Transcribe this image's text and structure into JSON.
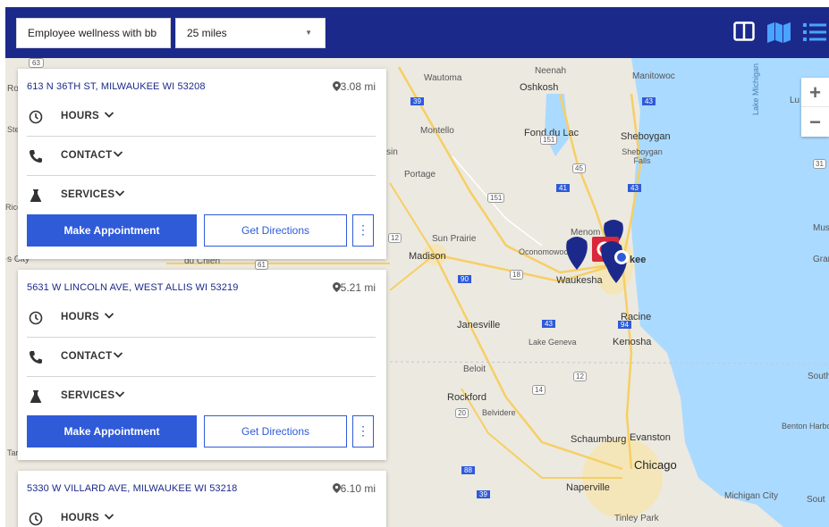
{
  "toolbar": {
    "search_value": "Employee wellness with bb",
    "radius_value": "25 miles",
    "view_icons": [
      "split-view-icon",
      "map-view-icon",
      "list-view-icon"
    ],
    "accent_color": "#1b2a8a",
    "button_color": "#2f5bd9"
  },
  "map": {
    "zoom_in": "+",
    "zoom_out": "−",
    "labels": {
      "waupaca": "Wautoma",
      "oshkosh": "Oshkosh",
      "neenah": "Neenah",
      "manitowoc": "Manitowoc",
      "montello": "Montello",
      "fonddulac": "Fond du Lac",
      "sheboygan": "Sheboygan",
      "sheboyganfalls": "Sheboygan Falls",
      "portage": "Portage",
      "sunprairie": "Sun Prairie",
      "madison": "Madison",
      "oconomowoc": "Oconomowoc",
      "menomonee": "Menom",
      "milwaukee": "kee",
      "waukesha": "Waukesha",
      "janesville": "Janesville",
      "racine": "Racine",
      "lakegeneva": "Lake Geneva",
      "kenosha": "Kenosha",
      "beloit": "Beloit",
      "rockford": "Rockford",
      "belvidere": "Belvidere",
      "schaumburg": "Schaumburg",
      "evanston": "Evanston",
      "chicago": "Chicago",
      "naperville": "Naperville",
      "tinleypark": "Tinley Park",
      "michigancity": "Michigan City",
      "southhaven": "South",
      "bentonharbor": "Benton Harbo",
      "grand": "Gran",
      "muskegon": "Mus",
      "lakemichigan": "Lake Michigan",
      "ludington": "Lu",
      "duchien": "du Chien",
      "ro": "Ro",
      "ste": "Ste",
      "ric": "Rice",
      "scity": "s City",
      "sin": "sin",
      "sout": "Sout",
      "tar": "Tar",
      "hw63": "63",
      "hw10": "10",
      "hw41": "41",
      "hw151": "151",
      "hw45": "45",
      "hw43": "43",
      "hw90": "90",
      "hw39": "39",
      "hw12": "12",
      "hw18": "18",
      "hw94": "94",
      "hw14": "14",
      "hw20": "20",
      "hw88": "88",
      "hw31": "31",
      "hw61": "61",
      "hw55": "55"
    }
  },
  "locations": [
    {
      "address": "613 N 36TH ST, MILWAUKEE WI 53208",
      "distance": "3.08 mi",
      "hours": "HOURS",
      "contact": "CONTACT",
      "services": "SERVICES",
      "appointment": "Make Appointment",
      "directions": "Get Directions",
      "more": "⋮"
    },
    {
      "address": "5631 W LINCOLN AVE, WEST ALLIS WI 53219",
      "distance": "5.21 mi",
      "hours": "HOURS",
      "contact": "CONTACT",
      "services": "SERVICES",
      "appointment": "Make Appointment",
      "directions": "Get Directions",
      "more": "⋮"
    },
    {
      "address": "5330 W VILLARD AVE, MILWAUKEE WI 53218",
      "distance": "6.10 mi",
      "hours": "HOURS"
    }
  ]
}
